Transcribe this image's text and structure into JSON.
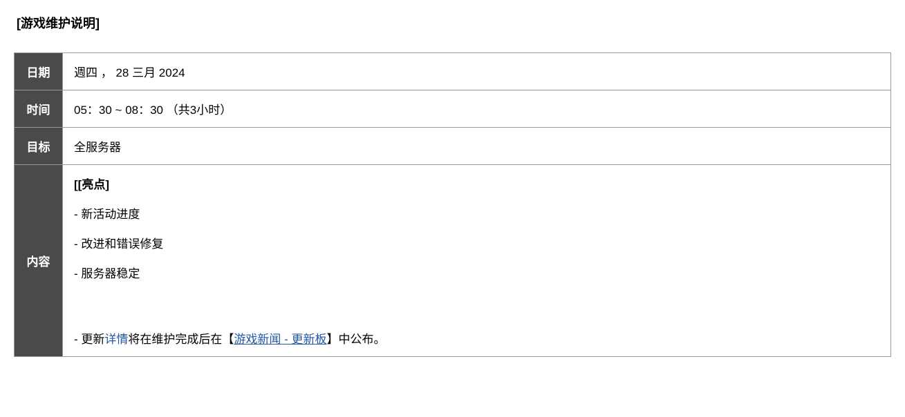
{
  "title": "[游戏维护说明]",
  "rows": {
    "date": {
      "label": "日期",
      "value": "週四 ， 28 三月 2024"
    },
    "time": {
      "label": "时间",
      "value": "05：30 ~ 08：30 （共3小时）"
    },
    "target": {
      "label": "目标",
      "value": "全服务器"
    },
    "content": {
      "label": "内容",
      "highlight_title": "[[亮点]",
      "items": [
        "- 新活动进度",
        "- 改进和错误修复",
        "- 服务器稳定"
      ],
      "footer": {
        "dash": "-  ",
        "update": "更新",
        "detail": "详情",
        "middle": "将在维护完成后在",
        "bracket_open": "【",
        "news_link": "游戏新闻 - 更新板",
        "bracket_close": "】",
        "tail": "中公布。"
      }
    }
  }
}
